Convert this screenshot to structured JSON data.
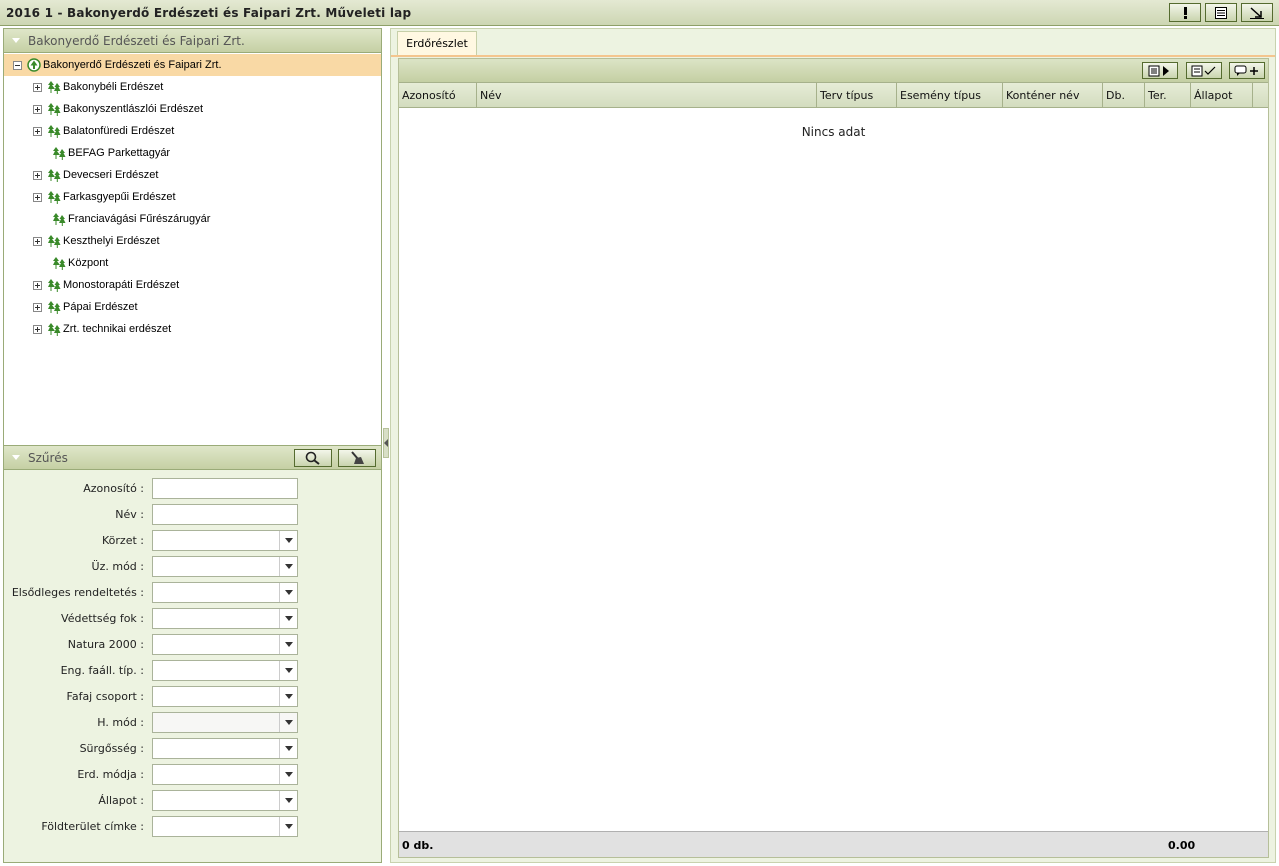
{
  "window": {
    "title": "2016 1 - Bakonyerdő Erdészeti és Faipari Zrt. Műveleti lap",
    "buttons": [
      {
        "icon": "exclamation-icon"
      },
      {
        "icon": "document-list-icon"
      },
      {
        "icon": "arrow-down-right-icon"
      }
    ]
  },
  "tree_panel": {
    "header": "Bakonyerdő Erdészeti és Faipari Zrt.",
    "root": "Bakonyerdő Erdészeti és Faipari Zrt.",
    "items": [
      {
        "label": "Bakonybéli Erdészet",
        "expandable": true
      },
      {
        "label": "Bakonyszentlászlói Erdészet",
        "expandable": true
      },
      {
        "label": "Balatonfüredi Erdészet",
        "expandable": true
      },
      {
        "label": "BEFAG Parkettagyár",
        "expandable": false
      },
      {
        "label": "Devecseri Erdészet",
        "expandable": true
      },
      {
        "label": "Farkasgyepűi Erdészet",
        "expandable": true
      },
      {
        "label": "Franciavágási Fűrészárugyár",
        "expandable": false
      },
      {
        "label": "Keszthelyi Erdészet",
        "expandable": true
      },
      {
        "label": "Központ",
        "expandable": false
      },
      {
        "label": "Monostorapáti Erdészet",
        "expandable": true
      },
      {
        "label": "Pápai Erdészet",
        "expandable": true
      },
      {
        "label": "Zrt. technikai erdészet",
        "expandable": true
      }
    ]
  },
  "filter_panel": {
    "header": "Szűrés",
    "fields": [
      {
        "label": "Azonosító :",
        "type": "text",
        "value": ""
      },
      {
        "label": "Név :",
        "type": "text",
        "value": ""
      },
      {
        "label": "Körzet :",
        "type": "select",
        "value": ""
      },
      {
        "label": "Üz. mód :",
        "type": "select",
        "value": ""
      },
      {
        "label": "Elsődleges rendeltetés :",
        "type": "select",
        "value": ""
      },
      {
        "label": "Védettség fok :",
        "type": "select",
        "value": ""
      },
      {
        "label": "Natura 2000 :",
        "type": "select",
        "value": ""
      },
      {
        "label": "Eng. faáll. típ. :",
        "type": "select",
        "value": ""
      },
      {
        "label": "Fafaj csoport :",
        "type": "select",
        "value": ""
      },
      {
        "label": "H. mód :",
        "type": "select",
        "value": ""
      },
      {
        "label": "Sürgősség :",
        "type": "select",
        "value": ""
      },
      {
        "label": "Erd. módja :",
        "type": "select",
        "value": ""
      },
      {
        "label": "Állapot :",
        "type": "select",
        "value": ""
      },
      {
        "label": "Földterület címke :",
        "type": "select",
        "value": ""
      }
    ]
  },
  "main": {
    "tab": "Erdőrészlet",
    "columns": [
      "Azonosító",
      "Név",
      "Terv típus",
      "Esemény típus",
      "Konténer név",
      "Db.",
      "Ter.",
      "Állapot"
    ],
    "empty_text": "Nincs adat",
    "footer_count": "0 db.",
    "footer_sum": "0.00"
  },
  "colors": {
    "header_green": "#cdd6b3",
    "selected_row": "#f9d9a5",
    "panel_bg": "#edf3e1",
    "tree_icon": "#3a8a2a"
  }
}
